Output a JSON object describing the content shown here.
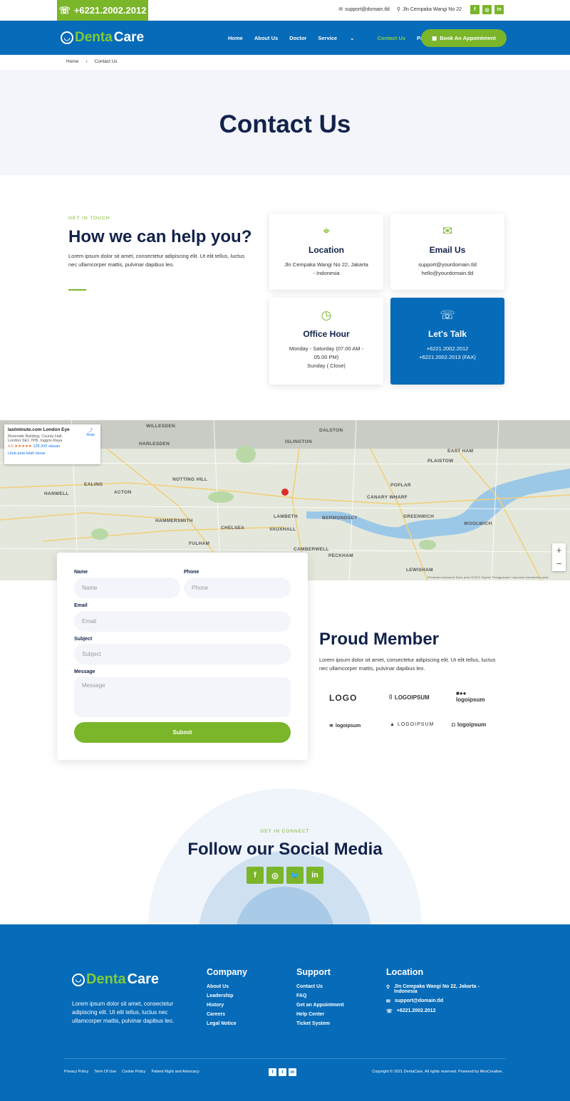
{
  "topbar": {
    "phone": "+6221.2002.2012",
    "email": "support@domain.tld",
    "address": "Jln Cempaka Wangi No 22",
    "social": [
      "fb",
      "ig",
      "in"
    ]
  },
  "brand": {
    "part1": "Denta",
    "part2": "Care"
  },
  "nav": {
    "items": [
      "Home",
      "About Us",
      "Doctor",
      "Service",
      "Contact Us",
      "Page"
    ],
    "cta": "Book An Appointment"
  },
  "breadcrumb": {
    "home": "Home",
    "current": "Contact Us"
  },
  "hero": {
    "title": "Contact Us"
  },
  "help": {
    "eyebrow": "GET IN TOUCH",
    "title": "How we can help you?",
    "text": "Lorem ipsum dolor sit amet, consectetur adipiscing elit. Ut elit tellus, luctus nec ullamcorper mattis, pulvinar dapibus leo."
  },
  "cards": {
    "location": {
      "title": "Location",
      "l1": "Jln Cempaka Wangi No 22, Jakarta",
      "l2": "- Indonesia"
    },
    "email": {
      "title": "Email Us",
      "l1": "support@yourdomain.tld",
      "l2": "hello@yourdomain.tld"
    },
    "office": {
      "title": "Office Hour",
      "l1": "Monday - Saturday (07.00 AM -",
      "l2": "05.00 PM)",
      "l3": "Sunday ( Close)"
    },
    "talk": {
      "title": "Let's Talk",
      "l1": "+6221.2002.2012",
      "l2": "+6221.2002.2013 (FAX)"
    }
  },
  "map": {
    "place": "lastminute.com London Eye",
    "address": "Riverside Building, County Hall, London SE1 7PB, Inggris Raya",
    "rating": "4,5 ★★★★★",
    "reviews": "128.209 ulasan",
    "route": "Rute",
    "larger": "Lihat peta lebih besar",
    "labels": [
      "WILLESDEN",
      "HARLESDEN",
      "ISLINGTON",
      "DALSTON",
      "EALING",
      "ACTON",
      "NOTTING HILL",
      "HANWELL",
      "HAMMERSMITH",
      "CHELSEA",
      "LAMBETH",
      "VAUXHALL",
      "BERMONDSEY",
      "POPLAR",
      "CANARY WHARF",
      "GREENWICH",
      "WOOLWICH",
      "PECKHAM",
      "LEWISHAM",
      "CAMBERWELL",
      "FULHAM",
      "PLAISTOW",
      "EAST HAM"
    ],
    "footer": "Pintasan keyboard   Data peta ©2021   Syarat Penggunaan   Laporkan kesalahan peta"
  },
  "form": {
    "name_label": "Name",
    "name_ph": "Name",
    "phone_label": "Phone",
    "phone_ph": "Phone",
    "email_label": "Email",
    "email_ph": "Email",
    "subject_label": "Subject",
    "subject_ph": "Subject",
    "message_label": "Message",
    "message_ph": "Message",
    "submit": "Submit"
  },
  "proud": {
    "title": "Proud Member",
    "text": "Lorem ipsum dolor sit amet, consectetur adipiscing elit. Ut elit tellus, luctus nec ullamcorper mattis, pulvinar dapibus leo.",
    "logos": [
      "LOGO",
      "LOGOIPSUM",
      "logoipsum",
      "logoipsum",
      "LOGOIPSUM",
      "logoipsum"
    ]
  },
  "social": {
    "eyebrow": "GET IN CONNECT",
    "title": "Follow our Social Media"
  },
  "footer": {
    "desc": "Lorem ipsum dolor sit amet, consectetur adipiscing elit. Ut elit tellus, luctus nec ullamcorper mattis, pulvinar dapibus leo.",
    "company": {
      "title": "Company",
      "links": [
        "About Us",
        "Leadership",
        "History",
        "Careers",
        "Legal Notice"
      ]
    },
    "support": {
      "title": "Support",
      "links": [
        "Contact Us",
        "FAQ",
        "Get an Appointment",
        "Help Center",
        "Ticket System"
      ]
    },
    "location": {
      "title": "Location",
      "address1": "Jln Cempaka Wangi No 22, Jakarta -",
      "address2": "Indonesia",
      "email": "support@domain.tld",
      "phone": "+6221.2002.2012"
    },
    "bottom_links": [
      "Privacy Policy",
      "Term Of Use",
      "Cookie Policy",
      "Patient Right and Advocacy"
    ],
    "copyright": "Copyright © 2021 DentaCare, All rights reserved. Powered by MoxCreative."
  },
  "colors": {
    "primary": "#066bb8",
    "accent": "#7ab52a",
    "navy": "#12224a"
  }
}
